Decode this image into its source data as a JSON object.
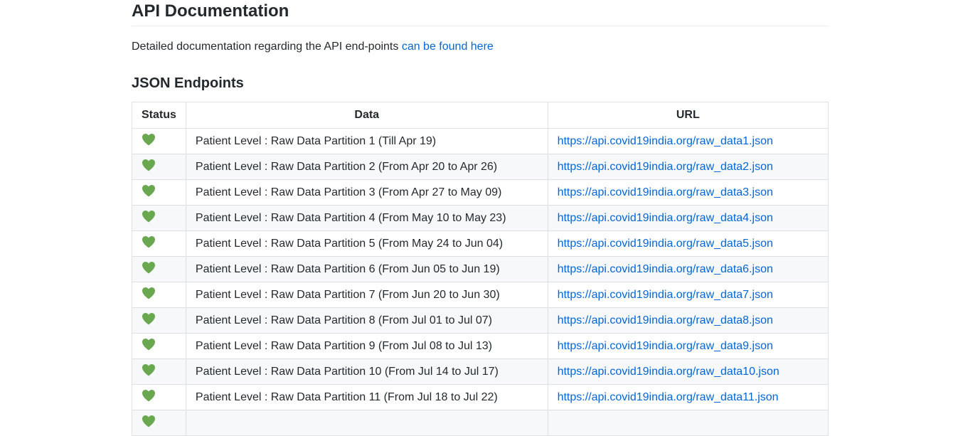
{
  "page": {
    "title": "API Documentation",
    "description_text": "Detailed documentation regarding the API end-points ",
    "description_link": "can be found here",
    "section_title": "JSON Endpoints"
  },
  "table": {
    "headers": [
      "Status",
      "Data",
      "URL"
    ],
    "status_icon": "green-heart-icon",
    "status_color": "#6aa84f",
    "rows": [
      {
        "data": "Patient Level : Raw Data Partition 1 (Till Apr 19)",
        "url": "https://api.covid19india.org/raw_data1.json"
      },
      {
        "data": "Patient Level : Raw Data Partition 2 (From Apr 20 to Apr 26)",
        "url": "https://api.covid19india.org/raw_data2.json"
      },
      {
        "data": "Patient Level : Raw Data Partition 3 (From Apr 27 to May 09)",
        "url": "https://api.covid19india.org/raw_data3.json"
      },
      {
        "data": "Patient Level : Raw Data Partition 4 (From May 10 to May 23)",
        "url": "https://api.covid19india.org/raw_data4.json"
      },
      {
        "data": "Patient Level : Raw Data Partition 5 (From May 24 to Jun 04)",
        "url": "https://api.covid19india.org/raw_data5.json"
      },
      {
        "data": "Patient Level : Raw Data Partition 6 (From Jun 05 to Jun 19)",
        "url": "https://api.covid19india.org/raw_data6.json"
      },
      {
        "data": "Patient Level : Raw Data Partition 7 (From Jun 20 to Jun 30)",
        "url": "https://api.covid19india.org/raw_data7.json"
      },
      {
        "data": "Patient Level : Raw Data Partition 8 (From Jul 01 to Jul 07)",
        "url": "https://api.covid19india.org/raw_data8.json"
      },
      {
        "data": "Patient Level : Raw Data Partition 9 (From Jul 08 to Jul 13)",
        "url": "https://api.covid19india.org/raw_data9.json"
      },
      {
        "data": "Patient Level : Raw Data Partition 10 (From Jul 14 to Jul 17)",
        "url": "https://api.covid19india.org/raw_data10.json"
      },
      {
        "data": "Patient Level : Raw Data Partition 11 (From Jul 18 to Jul 22)",
        "url": "https://api.covid19india.org/raw_data11.json"
      },
      {
        "data": "",
        "url": ""
      }
    ]
  }
}
